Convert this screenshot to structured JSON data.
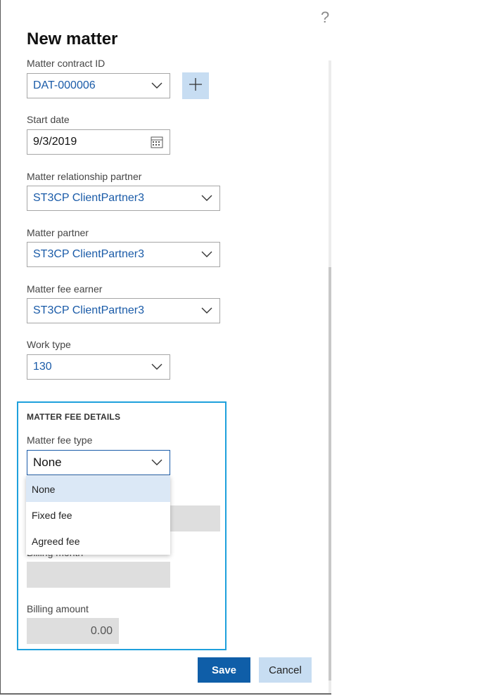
{
  "dialog": {
    "help_glyph": "?",
    "title": "New matter"
  },
  "fields": {
    "contract_id": {
      "label": "Matter contract ID",
      "value": "DAT-000006"
    },
    "start_date": {
      "label": "Start date",
      "value": "9/3/2019"
    },
    "relationship_partner": {
      "label": "Matter relationship partner",
      "value": "ST3CP ClientPartner3"
    },
    "matter_partner": {
      "label": "Matter partner",
      "value": "ST3CP ClientPartner3"
    },
    "fee_earner": {
      "label": "Matter fee earner",
      "value": "ST3CP ClientPartner3"
    },
    "work_type": {
      "label": "Work type",
      "value": "130"
    }
  },
  "fee_details": {
    "section_title": "MATTER FEE DETAILS",
    "fee_type": {
      "label": "Matter fee type",
      "value": "None"
    },
    "options": [
      "None",
      "Fixed fee",
      "Agreed fee"
    ],
    "billing_month": {
      "label": "Billing month"
    },
    "billing_amount": {
      "label": "Billing amount",
      "value": "0.00"
    }
  },
  "actions": {
    "save": "Save",
    "cancel": "Cancel"
  },
  "colors": {
    "accent": "#0f5ea8",
    "focus_border": "#1ea0dc",
    "value_text": "#1a5ba8"
  }
}
